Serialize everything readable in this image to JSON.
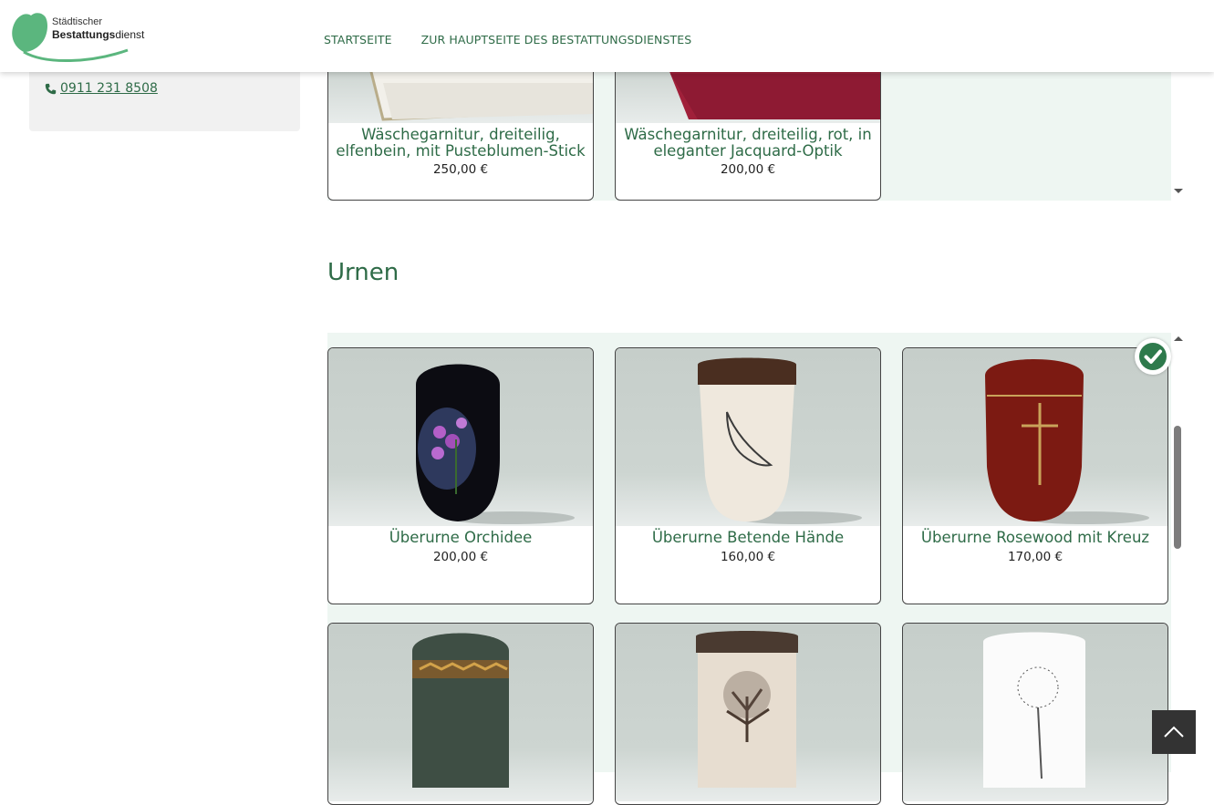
{
  "header": {
    "logo_line1": "Städtischer",
    "logo_line2_bold": "Bestattungs",
    "logo_line2_rest": "dienst",
    "nav": [
      {
        "label": "STARTSEITE"
      },
      {
        "label": "ZUR HAUPTSEITE DES BESTATTUNGSDIENSTES"
      }
    ]
  },
  "sidebar": {
    "phone_icon": "phone-icon",
    "phone": "0911 231 8508"
  },
  "linens": {
    "products": [
      {
        "title_line1": "Wäschegarnitur, dreiteilig,",
        "title_line2": "elfenbein, mit Pusteblumen-Stick",
        "price": "250,00 €"
      },
      {
        "title_line1": "Wäschegarnitur, dreiteilig, rot, in",
        "title_line2": "eleganter Jacquard-Optik",
        "price": "200,00 €"
      }
    ]
  },
  "urns": {
    "section_title": "Urnen",
    "selected_icon": "check-circle-icon",
    "products": [
      {
        "title": "Überurne Orchidee",
        "price": "200,00 €"
      },
      {
        "title": "Überurne Betende Hände",
        "price": "160,00 €"
      },
      {
        "title": "Überurne Rosewood mit Kreuz",
        "price": "170,00 €"
      }
    ]
  },
  "colors": {
    "accent": "#2e6b47",
    "panel_bg": "#eef6f2",
    "check": "#2e7a4c"
  },
  "to_top_icon": "chevron-up-icon"
}
